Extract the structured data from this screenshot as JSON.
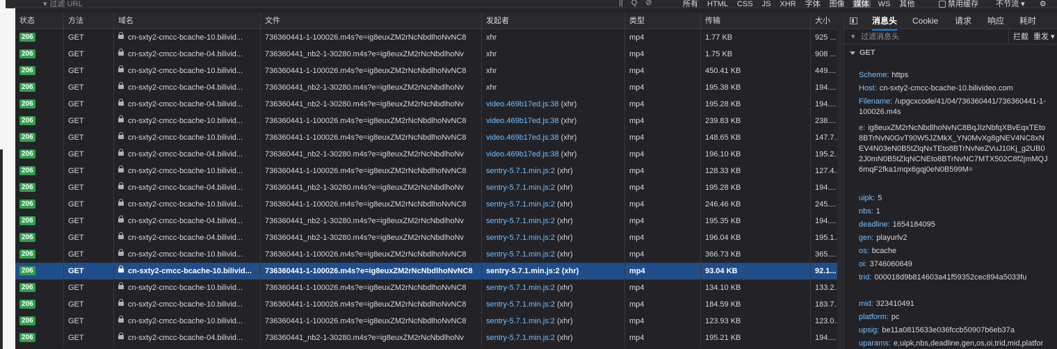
{
  "toolbar": {
    "filter_placeholder": "过滤 URL",
    "tools": [
      "||",
      "Q",
      "⊘"
    ],
    "types": [
      "所有",
      "HTML",
      "CSS",
      "JS",
      "XHR",
      "字体",
      "图像",
      "媒体",
      "WS",
      "其他"
    ],
    "active_type": "媒体",
    "disable_cache": "禁用缓存",
    "throttle": "不节流 ▾",
    "settings_icon": "gear-icon"
  },
  "columns": [
    "状态",
    "方法",
    "域名",
    "文件",
    "发起者",
    "类型",
    "传输",
    "大小"
  ],
  "rows": [
    {
      "status": "206",
      "method": "GET",
      "domain": "cn-sxty2-cmcc-bcache-10.bilivid...",
      "file": "736360441-1-100026.m4s?e=ig8euxZM2rNcNbdlhoNvNC8",
      "initiator": "xhr",
      "initiator_suffix": "",
      "type": "mp4",
      "transfer": "1.77 KB",
      "size": "925 ..."
    },
    {
      "status": "206",
      "method": "GET",
      "domain": "cn-sxty2-cmcc-bcache-04.bilivid...",
      "file": "736360441_nb2-1-30280.m4s?e=ig8euxZM2rNcNbdlhoNv",
      "initiator": "xhr",
      "initiator_suffix": "",
      "type": "mp4",
      "transfer": "1.75 KB",
      "size": "908 ..."
    },
    {
      "status": "206",
      "method": "GET",
      "domain": "cn-sxty2-cmcc-bcache-10.bilivid...",
      "file": "736360441-1-100026.m4s?e=ig8euxZM2rNcNbdlhoNvNC8",
      "initiator": "xhr",
      "initiator_suffix": "",
      "type": "mp4",
      "transfer": "450.41 KB",
      "size": "449...."
    },
    {
      "status": "206",
      "method": "GET",
      "domain": "cn-sxty2-cmcc-bcache-04.bilivid...",
      "file": "736360441_nb2-1-30280.m4s?e=ig8euxZM2rNcNbdlhoNv",
      "initiator": "xhr",
      "initiator_suffix": "",
      "type": "mp4",
      "transfer": "195.38 KB",
      "size": "194...."
    },
    {
      "status": "206",
      "method": "GET",
      "domain": "cn-sxty2-cmcc-bcache-04.bilivid...",
      "file": "736360441_nb2-1-30280.m4s?e=ig8euxZM2rNcNbdlhoNv",
      "initiator": "video.469b17ed.js:38",
      "initiator_suffix": " (xhr)",
      "type": "mp4",
      "transfer": "195.28 KB",
      "size": "194...."
    },
    {
      "status": "206",
      "method": "GET",
      "domain": "cn-sxty2-cmcc-bcache-10.bilivid...",
      "file": "736360441-1-100026.m4s?e=ig8euxZM2rNcNbdlhoNvNC8",
      "initiator": "video.469b17ed.js:38",
      "initiator_suffix": " (xhr)",
      "type": "mp4",
      "transfer": "239.83 KB",
      "size": "238...."
    },
    {
      "status": "206",
      "method": "GET",
      "domain": "cn-sxty2-cmcc-bcache-10.bilivid...",
      "file": "736360441-1-100026.m4s?e=ig8euxZM2rNcNbdlhoNvNC8",
      "initiator": "video.469b17ed.js:38",
      "initiator_suffix": " (xhr)",
      "type": "mp4",
      "transfer": "148.65 KB",
      "size": "147.7..."
    },
    {
      "status": "206",
      "method": "GET",
      "domain": "cn-sxty2-cmcc-bcache-04.bilivid...",
      "file": "736360441_nb2-1-30280.m4s?e=ig8euxZM2rNcNbdlhoNv",
      "initiator": "video.469b17ed.js:38",
      "initiator_suffix": " (xhr)",
      "type": "mp4",
      "transfer": "196.10 KB",
      "size": "195.2..."
    },
    {
      "status": "206",
      "method": "GET",
      "domain": "cn-sxty2-cmcc-bcache-10.bilivid...",
      "file": "736360441-1-100026.m4s?e=ig8euxZM2rNcNbdlhoNvNC8",
      "initiator": "sentry-5.7.1.min.js:2",
      "initiator_suffix": " (xhr)",
      "type": "mp4",
      "transfer": "128.33 KB",
      "size": "127.4..."
    },
    {
      "status": "206",
      "method": "GET",
      "domain": "cn-sxty2-cmcc-bcache-04.bilivid...",
      "file": "736360441_nb2-1-30280.m4s?e=ig8euxZM2rNcNbdlhoNv",
      "initiator": "sentry-5.7.1.min.js:2",
      "initiator_suffix": " (xhr)",
      "type": "mp4",
      "transfer": "195.28 KB",
      "size": "194...."
    },
    {
      "status": "206",
      "method": "GET",
      "domain": "cn-sxty2-cmcc-bcache-10.bilivid...",
      "file": "736360441-1-100026.m4s?e=ig8euxZM2rNcNbdlhoNvNC8",
      "initiator": "sentry-5.7.1.min.js:2",
      "initiator_suffix": " (xhr)",
      "type": "mp4",
      "transfer": "246.46 KB",
      "size": "245...."
    },
    {
      "status": "206",
      "method": "GET",
      "domain": "cn-sxty2-cmcc-bcache-04.bilivid...",
      "file": "736360441_nb2-1-30280.m4s?e=ig8euxZM2rNcNbdlhoNv",
      "initiator": "sentry-5.7.1.min.js:2",
      "initiator_suffix": " (xhr)",
      "type": "mp4",
      "transfer": "195.35 KB",
      "size": "194...."
    },
    {
      "status": "206",
      "method": "GET",
      "domain": "cn-sxty2-cmcc-bcache-04.bilivid...",
      "file": "736360441_nb2-1-30280.m4s?e=ig8euxZM2rNcNbdlhoNv",
      "initiator": "sentry-5.7.1.min.js:2",
      "initiator_suffix": " (xhr)",
      "type": "mp4",
      "transfer": "196.04 KB",
      "size": "195.1..."
    },
    {
      "status": "206",
      "method": "GET",
      "domain": "cn-sxty2-cmcc-bcache-10.bilivid...",
      "file": "736360441-1-100026.m4s?e=ig8euxZM2rNcNbdlhoNvNC8",
      "initiator": "sentry-5.7.1.min.js:2",
      "initiator_suffix": " (xhr)",
      "type": "mp4",
      "transfer": "366.73 KB",
      "size": "365...."
    },
    {
      "status": "206",
      "method": "GET",
      "domain": "cn-sxty2-cmcc-bcache-10.bilivid...",
      "file": "736360441-1-100026.m4s?e=ig8euxZM2rNcNbdlhoNvNC8",
      "initiator": "sentry-5.7.1.min.js:2",
      "initiator_suffix": " (xhr)",
      "type": "mp4",
      "transfer": "93.04 KB",
      "size": "92.1...",
      "selected": true
    },
    {
      "status": "206",
      "method": "GET",
      "domain": "cn-sxty2-cmcc-bcache-10.bilivid...",
      "file": "736360441-1-100026.m4s?e=ig8euxZM2rNcNbdlhoNvNC8",
      "initiator": "sentry-5.7.1.min.js:2",
      "initiator_suffix": " (xhr)",
      "type": "mp4",
      "transfer": "134.10 KB",
      "size": "133.2..."
    },
    {
      "status": "206",
      "method": "GET",
      "domain": "cn-sxty2-cmcc-bcache-10.bilivid...",
      "file": "736360441-1-100026.m4s?e=ig8euxZM2rNcNbdlhoNvNC8",
      "initiator": "sentry-5.7.1.min.js:2",
      "initiator_suffix": " (xhr)",
      "type": "mp4",
      "transfer": "184.59 KB",
      "size": "183.7..."
    },
    {
      "status": "206",
      "method": "GET",
      "domain": "cn-sxty2-cmcc-bcache-10.bilivid...",
      "file": "736360441-1-100026.m4s?e=ig8euxZM2rNcNbdlhoNvNC8",
      "initiator": "sentry-5.7.1.min.js:2",
      "initiator_suffix": " (xhr)",
      "type": "mp4",
      "transfer": "123.93 KB",
      "size": "123.0..."
    },
    {
      "status": "206",
      "method": "GET",
      "domain": "cn-sxty2-cmcc-bcache-04.bilivid...",
      "file": "736360441_nb2-1-30280.m4s?e=ig8euxZM2rNcNbdlhoNv",
      "initiator": "sentry-5.7.1.min.js:2",
      "initiator_suffix": " (xhr)",
      "type": "mp4",
      "transfer": "195.21 KB",
      "size": "194...."
    }
  ],
  "panel": {
    "tabs": [
      "消息头",
      "Cookie",
      "请求",
      "响应",
      "耗时"
    ],
    "active_tab": "消息头",
    "filter_placeholder": "过滤消息头",
    "block_label": "拦截",
    "resend_label": "重发 ▾",
    "method": "GET",
    "fields": [
      {
        "k": "Scheme:",
        "v": "https"
      },
      {
        "k": "Host:",
        "v": "cn-sxty2-cmcc-bcache-10.bilivideo.com"
      },
      {
        "k": "Filename:",
        "v": "/upgcxcode/41/04/736360441/736360441-1-100026.m4s"
      },
      {
        "k": "e:",
        "v": "ig8euxZM2rNcNbdlhoNvNC8BqJIzNbfqXBvEqxTEto8BTrNvN0GvT90W5JZMkX_YN0MvXg8gNEV4NC8xNEV4N03eN0B5tZlqNxTEto8BTrNvNeZVuJ10Kj_g2UB02J0mN0B5tZlqNCNEto8BTrNvNC7MTX502C8f2jmMQJ6mqF2fka1mqx6gqj0eN0B599M="
      },
      {
        "k": "uipk:",
        "v": "5"
      },
      {
        "k": "nbs:",
        "v": "1"
      },
      {
        "k": "deadline:",
        "v": "1654184095"
      },
      {
        "k": "gen:",
        "v": "playurlv2"
      },
      {
        "k": "os:",
        "v": "bcache"
      },
      {
        "k": "oi:",
        "v": "3746060649"
      },
      {
        "k": "trid:",
        "v": "000018d9b814603a41f59352cec894a5033fu"
      },
      {
        "k": "mid:",
        "v": "323410491"
      },
      {
        "k": "platform:",
        "v": "pc"
      },
      {
        "k": "upsig:",
        "v": "be11a0815633e036fccb50907b6eb37a"
      },
      {
        "k": "uparams:",
        "v": "e,uipk,nbs,deadline,gen,os,oi,trid,mid,platform"
      }
    ]
  }
}
